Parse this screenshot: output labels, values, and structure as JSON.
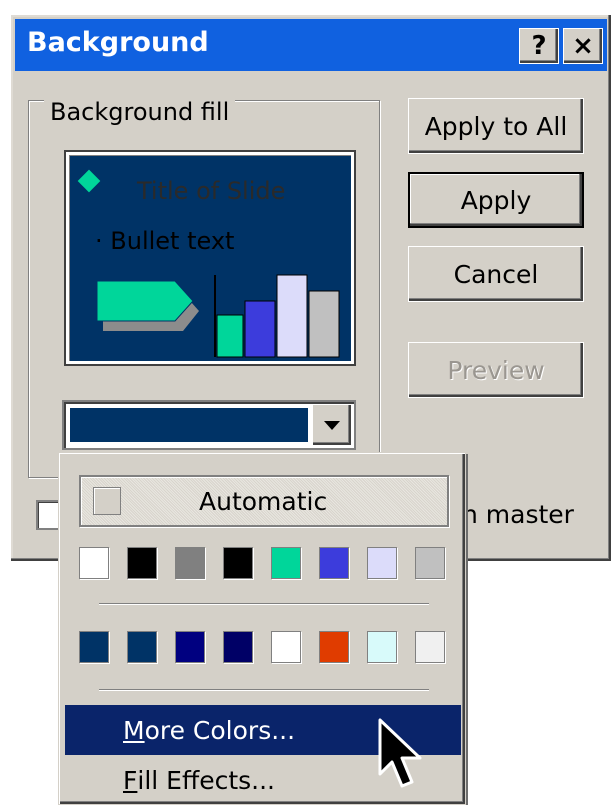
{
  "dialog": {
    "title": "Background",
    "help_button": "?",
    "close_button": "×",
    "group_label": "Background fill",
    "preview": {
      "title": "Title of Slide",
      "bullet": "Bullet text"
    },
    "selected_color": "#003366",
    "buttons": {
      "apply_all": "Apply to All",
      "apply": "Apply",
      "cancel": "Cancel",
      "preview": "Preview"
    },
    "omit_master_partial": "n master"
  },
  "palette": {
    "automatic_label": "Automatic",
    "row1": [
      "#ffffff",
      "#000000",
      "#808080",
      "#000000",
      "#00d69a",
      "#3c3cdc",
      "#dcdcfa",
      "#c0c0c0"
    ],
    "row2": [
      "#003366",
      "#003366",
      "#000080",
      "#000066",
      "#ffffff",
      "#e03c00",
      "#d8fafa",
      "#f0f0f0"
    ],
    "menu": {
      "more_colors_mn": "M",
      "more_colors_rest": "ore Colors...",
      "fill_effects_mn": "F",
      "fill_effects_rest": "ill Effects..."
    }
  },
  "colors": {
    "title_bar": "#1061e0",
    "dialog_face": "#d4d0c8",
    "highlight": "#0a246a",
    "preview_bg": "#003366",
    "accent_green": "#00d69a"
  }
}
